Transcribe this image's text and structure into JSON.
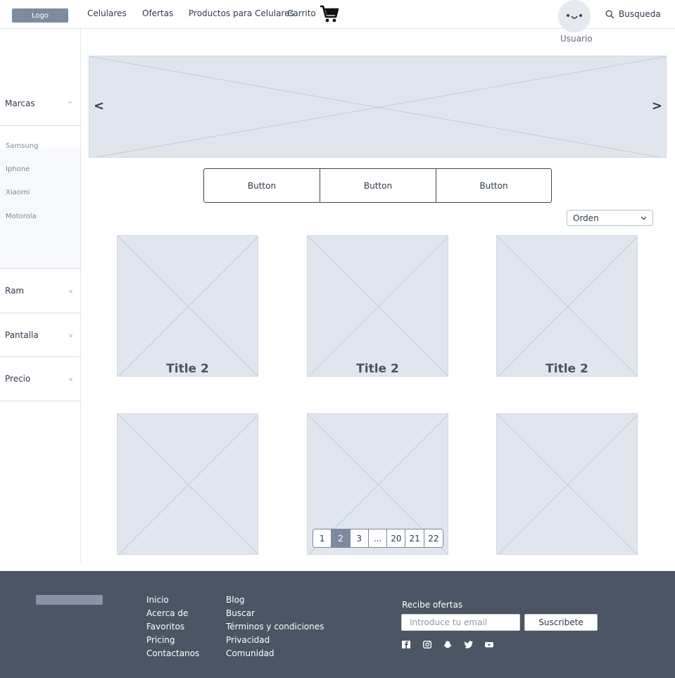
{
  "header": {
    "logo_label": "Logo",
    "nav": [
      "Celulares",
      "Ofertas",
      "Productos para Celulares",
      "Carrito"
    ],
    "cart_icon": "shopping-cart-icon",
    "user_label": "Usuario",
    "user_icon": "avatar-face-icon",
    "search_label": "Busqueda",
    "search_icon": "search-icon"
  },
  "sidebar": {
    "sections": [
      {
        "label": "Marcas",
        "chevron": "^"
      },
      {
        "label": "Ram",
        "chevron": "v"
      },
      {
        "label": "Pantalla",
        "chevron": "v"
      },
      {
        "label": "Precio",
        "chevron": "v"
      }
    ],
    "brands": [
      "Samsung",
      "Iphone",
      "Xiaomi",
      "Motorola"
    ]
  },
  "carousel": {
    "prev": "<",
    "next": ">"
  },
  "button_group": [
    "Button",
    "Button",
    "Button"
  ],
  "sort": {
    "label": "Orden"
  },
  "cards": [
    {
      "title": "Title 2"
    },
    {
      "title": "Title 2"
    },
    {
      "title": "Title 2"
    },
    {
      "title": ""
    },
    {
      "title": ""
    },
    {
      "title": ""
    }
  ],
  "pagination": {
    "pages": [
      "1",
      "2",
      "3",
      "...",
      "20",
      "21",
      "22"
    ],
    "active": "2"
  },
  "footer": {
    "col1": [
      "Inicio",
      "Acerca de",
      "Favoritos",
      "Pricing",
      "Contactanos"
    ],
    "col2": [
      "Blog",
      "Buscar",
      "Términos y condiciones",
      "Privacidad",
      "Comunidad"
    ],
    "newsletter_title": "Recibe ofertas",
    "email_placeholder": "Introduce tu email",
    "subscribe_label": "Suscribete",
    "social_icons": [
      "facebook-icon",
      "instagram-icon",
      "snapchat-icon",
      "twitter-icon",
      "youtube-icon"
    ]
  },
  "colors": {
    "placeholder_fill": "#e1e6ee",
    "footer_bg": "#4b5563",
    "accent": "#7d8ba0"
  }
}
